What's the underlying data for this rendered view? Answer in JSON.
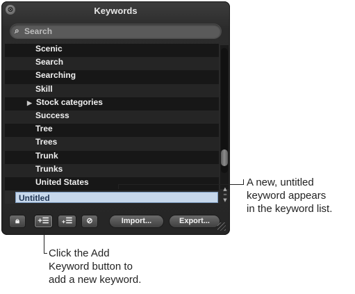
{
  "window": {
    "title": "Keywords",
    "close_glyph": "⊗"
  },
  "search": {
    "placeholder": "Search",
    "icon": "search-icon"
  },
  "keywords": [
    {
      "label": "Scenic",
      "expandable": false
    },
    {
      "label": "Search",
      "expandable": false
    },
    {
      "label": "Searching",
      "expandable": false
    },
    {
      "label": "Skill",
      "expandable": false
    },
    {
      "label": "Stock categories",
      "expandable": true
    },
    {
      "label": "Success",
      "expandable": false
    },
    {
      "label": "Tree",
      "expandable": false
    },
    {
      "label": "Trees",
      "expandable": false
    },
    {
      "label": "Trunk",
      "expandable": false
    },
    {
      "label": "Trunks",
      "expandable": false
    },
    {
      "label": "United States",
      "expandable": false
    }
  ],
  "new_keyword": {
    "value": "Untitled"
  },
  "toolbar": {
    "lock_icon": "lock-icon",
    "add_keyword_icon": "add-keyword-icon",
    "add_child_icon": "add-child-keyword-icon",
    "remove_icon": "remove-icon",
    "import_label": "Import...",
    "export_label": "Export..."
  },
  "callouts": {
    "new_keyword": [
      "A new, untitled",
      "keyword appears",
      "in the keyword list."
    ],
    "add_button": [
      "Click the Add",
      "Keyword button to",
      "add a new keyword."
    ]
  },
  "colors": {
    "panel_bg": "#2b2b2b",
    "selection": "#c7d8ec"
  }
}
